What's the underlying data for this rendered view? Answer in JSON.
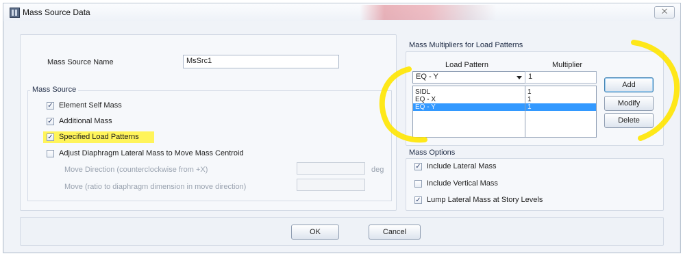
{
  "window": {
    "title": "Mass Source Data",
    "close_glyph": "⨉"
  },
  "left": {
    "name_label": "Mass Source Name",
    "name_value": "MsSrc1",
    "mass_source": {
      "title": "Mass Source",
      "options": [
        {
          "label": "Element Self Mass",
          "checked": true
        },
        {
          "label": "Additional Mass",
          "checked": true
        },
        {
          "label": "Specified Load Patterns",
          "checked": true
        },
        {
          "label": "Adjust Diaphragm Lateral Mass to Move Mass Centroid",
          "checked": false
        }
      ],
      "move_direction_label": "Move Direction (counterclockwise from +X)",
      "move_direction_unit": "deg",
      "move_ratio_label": "Move (ratio to diaphragm dimension in move direction)"
    }
  },
  "right": {
    "multipliers": {
      "title": "Mass Multipliers for Load Patterns",
      "col_pattern": "Load Pattern",
      "col_multiplier": "Multiplier",
      "combo_value": "EQ - Y",
      "multiplier_input": "1",
      "rows": [
        {
          "pattern": "SIDL",
          "multiplier": "1",
          "selected": false
        },
        {
          "pattern": "EQ - X",
          "multiplier": "1",
          "selected": false
        },
        {
          "pattern": "EQ - Y",
          "multiplier": "1",
          "selected": true
        }
      ],
      "buttons": {
        "add": "Add",
        "modify": "Modify",
        "delete": "Delete"
      }
    },
    "mass_options": {
      "title": "Mass Options",
      "options": [
        {
          "label": "Include Lateral Mass",
          "checked": true
        },
        {
          "label": "Include Vertical Mass",
          "checked": false
        },
        {
          "label": "Lump Lateral Mass at Story Levels",
          "checked": true
        }
      ]
    }
  },
  "footer": {
    "ok": "OK",
    "cancel": "Cancel"
  },
  "colors": {
    "highlight": "#fff45a",
    "selection": "#3399ff",
    "annotation": "#ffe600"
  }
}
